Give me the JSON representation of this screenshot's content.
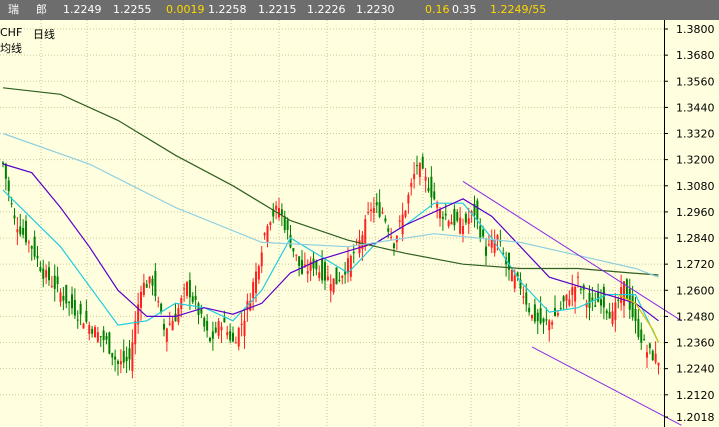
{
  "topbar": {
    "market": "瑞",
    "section": "郎",
    "v1": "1.2249",
    "v2": "1.2255",
    "change": "0.0019",
    "v3": "1.2258",
    "v4": "1.2215",
    "v5": "1.2226",
    "v6": "1.2230",
    "pct": "0.16",
    "v7": "0.35",
    "last_count": "1.2249/55"
  },
  "chart_title": {
    "symbol": "CHF",
    "period": "日线",
    "indicator": "均线"
  },
  "colors": {
    "topbar_bg": "#6D6D6D",
    "topbar_text": "#FFFFFF",
    "topbar_accent": "#FFD800",
    "background": "#FFFFE0",
    "grid": "#CACA9A",
    "bull": "#FF2020",
    "bear": "#008000",
    "ma_short": "#22CCDD",
    "ma_mid": "#5A00C8",
    "ma_long": "#2F5F1F",
    "ma_extra": "#8FCFE0",
    "ma_yellow": "#D8C000",
    "channel": "#8A2BE2"
  },
  "chart_data": {
    "type": "candlestick",
    "title": "CHF 日线",
    "y_ticks": [
      "1.3800",
      "1.3680",
      "1.3560",
      "1.3440",
      "1.3320",
      "1.3200",
      "1.3080",
      "1.2960",
      "1.2840",
      "1.2720",
      "1.2600",
      "1.2480",
      "1.2360",
      "1.2240",
      "1.2120",
      "1.2018"
    ],
    "ylim": [
      1.2018,
      1.39
    ],
    "grid": true,
    "anchor_closes": [
      [
        0,
        1.318
      ],
      [
        4,
        1.292
      ],
      [
        10,
        1.28
      ],
      [
        14,
        1.268
      ],
      [
        18,
        1.262
      ],
      [
        24,
        1.252
      ],
      [
        30,
        1.244
      ],
      [
        36,
        1.236
      ],
      [
        40,
        1.226
      ],
      [
        44,
        1.228
      ],
      [
        48,
        1.262
      ],
      [
        52,
        1.264
      ],
      [
        56,
        1.242
      ],
      [
        60,
        1.248
      ],
      [
        64,
        1.262
      ],
      [
        68,
        1.25
      ],
      [
        72,
        1.236
      ],
      [
        76,
        1.246
      ],
      [
        80,
        1.236
      ],
      [
        84,
        1.248
      ],
      [
        88,
        1.268
      ],
      [
        92,
        1.292
      ],
      [
        96,
        1.298
      ],
      [
        100,
        1.282
      ],
      [
        104,
        1.268
      ],
      [
        108,
        1.272
      ],
      [
        112,
        1.266
      ],
      [
        116,
        1.264
      ],
      [
        120,
        1.272
      ],
      [
        124,
        1.282
      ],
      [
        128,
        1.298
      ],
      [
        132,
        1.296
      ],
      [
        136,
        1.282
      ],
      [
        140,
        1.298
      ],
      [
        144,
        1.318
      ],
      [
        148,
        1.308
      ],
      [
        152,
        1.296
      ],
      [
        156,
        1.292
      ],
      [
        160,
        1.29
      ],
      [
        164,
        1.296
      ],
      [
        168,
        1.278
      ],
      [
        172,
        1.284
      ],
      [
        176,
        1.268
      ],
      [
        180,
        1.262
      ],
      [
        184,
        1.248
      ],
      [
        188,
        1.244
      ],
      [
        192,
        1.248
      ],
      [
        196,
        1.256
      ],
      [
        200,
        1.264
      ],
      [
        204,
        1.252
      ],
      [
        208,
        1.256
      ],
      [
        212,
        1.248
      ],
      [
        216,
        1.262
      ],
      [
        220,
        1.244
      ],
      [
        224,
        1.232
      ],
      [
        228,
        1.228
      ]
    ],
    "series": [
      {
        "name": "MA1",
        "values": [
          [
            0,
            1.306
          ],
          [
            20,
            1.28
          ],
          [
            40,
            1.244
          ],
          [
            50,
            1.246
          ],
          [
            60,
            1.254
          ],
          [
            70,
            1.252
          ],
          [
            80,
            1.246
          ],
          [
            90,
            1.26
          ],
          [
            100,
            1.284
          ],
          [
            110,
            1.276
          ],
          [
            120,
            1.268
          ],
          [
            130,
            1.282
          ],
          [
            140,
            1.29
          ],
          [
            150,
            1.3
          ],
          [
            160,
            1.3
          ],
          [
            170,
            1.284
          ],
          [
            180,
            1.264
          ],
          [
            190,
            1.25
          ],
          [
            200,
            1.252
          ],
          [
            210,
            1.258
          ],
          [
            220,
            1.258
          ],
          [
            228,
            1.236
          ]
        ]
      },
      {
        "name": "MA2",
        "values": [
          [
            0,
            1.318
          ],
          [
            10,
            1.314
          ],
          [
            20,
            1.298
          ],
          [
            30,
            1.28
          ],
          [
            40,
            1.26
          ],
          [
            50,
            1.248
          ],
          [
            60,
            1.248
          ],
          [
            70,
            1.252
          ],
          [
            80,
            1.249
          ],
          [
            90,
            1.254
          ],
          [
            100,
            1.268
          ],
          [
            110,
            1.274
          ],
          [
            120,
            1.278
          ],
          [
            130,
            1.282
          ],
          [
            140,
            1.29
          ],
          [
            150,
            1.296
          ],
          [
            160,
            1.302
          ],
          [
            170,
            1.294
          ],
          [
            180,
            1.28
          ],
          [
            190,
            1.266
          ],
          [
            200,
            1.262
          ],
          [
            210,
            1.258
          ],
          [
            220,
            1.254
          ],
          [
            228,
            1.246
          ]
        ]
      },
      {
        "name": "MA3",
        "values": [
          [
            0,
            1.353
          ],
          [
            20,
            1.35
          ],
          [
            40,
            1.338
          ],
          [
            60,
            1.322
          ],
          [
            80,
            1.308
          ],
          [
            100,
            1.292
          ],
          [
            120,
            1.283
          ],
          [
            140,
            1.277
          ],
          [
            160,
            1.272
          ],
          [
            180,
            1.27
          ],
          [
            200,
            1.27
          ],
          [
            218,
            1.268
          ],
          [
            228,
            1.267
          ]
        ]
      },
      {
        "name": "MA4",
        "values": [
          [
            0,
            1.332
          ],
          [
            30,
            1.318
          ],
          [
            60,
            1.298
          ],
          [
            90,
            1.282
          ],
          [
            120,
            1.28
          ],
          [
            150,
            1.286
          ],
          [
            180,
            1.282
          ],
          [
            200,
            1.276
          ],
          [
            220,
            1.27
          ],
          [
            228,
            1.266
          ]
        ]
      },
      {
        "name": "MA5",
        "values": [
          [
            214,
            1.258
          ],
          [
            220,
            1.254
          ],
          [
            226,
            1.242
          ],
          [
            228,
            1.236
          ]
        ]
      }
    ],
    "channel_lines": [
      {
        "values": [
          [
            160,
            1.31
          ],
          [
            236,
            1.246
          ]
        ]
      },
      {
        "values": [
          [
            184,
            1.234
          ],
          [
            236,
            1.198
          ]
        ]
      }
    ]
  }
}
